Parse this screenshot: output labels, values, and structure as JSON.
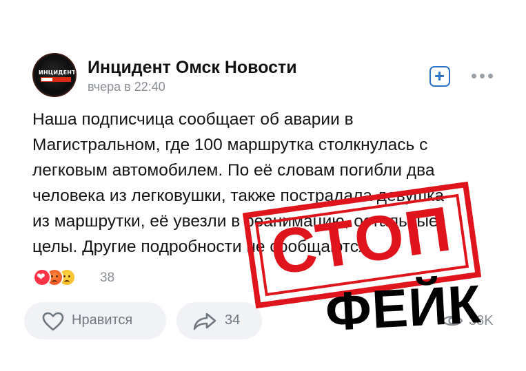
{
  "post": {
    "author": "Инцидент Омск Новости",
    "time": "вчера в 22:40",
    "avatar_text": "ИНЦИДЕНТ",
    "lines": [
      "Наша подписчица сообщает об аварии в",
      "Магистральном, где 100 маршрутка столкнулась с",
      "легковым автомобилем. По её словам погибли два",
      "человека из легковушки, также пострадала девушка",
      "из маршрутки, её увезли в реанимацию, остальные",
      "целы. Другие подробности не сообщаются."
    ]
  },
  "reactions": {
    "icons": [
      "heart-reaction",
      "angry-reaction",
      "sad-reaction"
    ],
    "count": "38"
  },
  "actions": {
    "like_label": "Нравится",
    "share_count": "34",
    "views": "38K"
  },
  "overlay": {
    "stamp_text": "СТОП",
    "fake_text": "ФЕЙК"
  },
  "colors": {
    "accent_blue": "#2b72c9",
    "stamp_red": "#e0141c",
    "muted_text": "#8a8f96",
    "button_bg": "#f0f2f5"
  }
}
